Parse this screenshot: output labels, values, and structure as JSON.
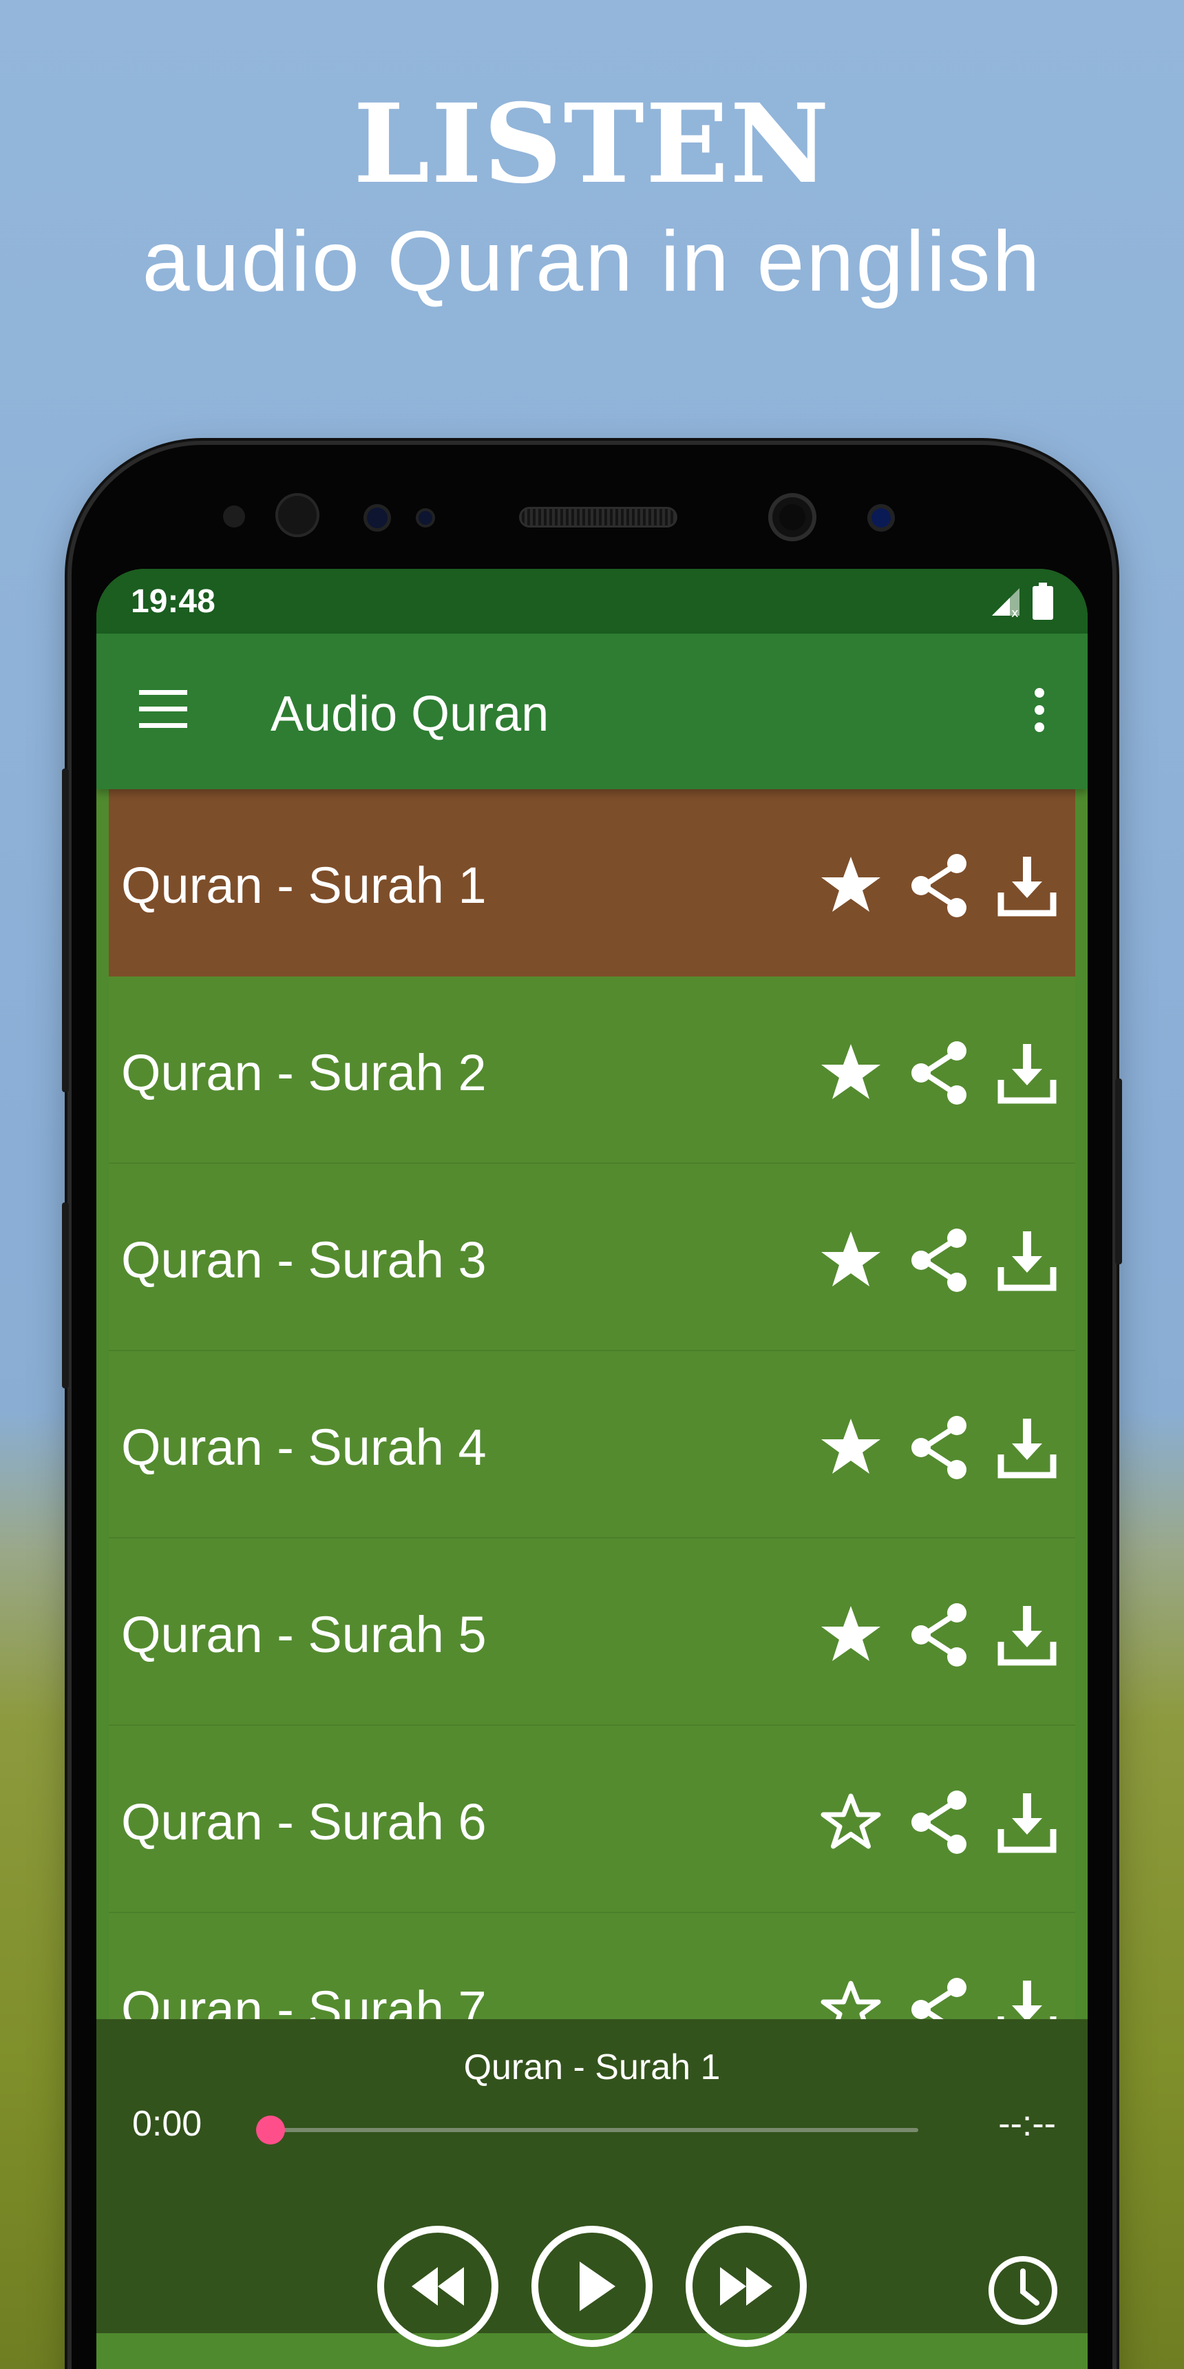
{
  "promo": {
    "title": "LISTEN",
    "subtitle": "audio Quran in english"
  },
  "status_bar": {
    "time": "19:48"
  },
  "app_bar": {
    "title": "Audio Quran",
    "menu_icon": "hamburger-menu-icon",
    "overflow_icon": "more-vert-icon"
  },
  "surahs": [
    {
      "label": "Quran - Surah 1",
      "favorite": true,
      "active": true
    },
    {
      "label": "Quran - Surah 2",
      "favorite": true,
      "active": false
    },
    {
      "label": "Quran - Surah 3",
      "favorite": true,
      "active": false
    },
    {
      "label": "Quran - Surah 4",
      "favorite": true,
      "active": false
    },
    {
      "label": "Quran - Surah 5",
      "favorite": true,
      "active": false
    },
    {
      "label": "Quran - Surah 6",
      "favorite": false,
      "active": false
    },
    {
      "label": "Quran - Surah 7",
      "favorite": false,
      "active": false
    }
  ],
  "player": {
    "now_playing": "Quran - Surah 1",
    "current_time": "0:00",
    "duration": "--:--",
    "progress": 0
  },
  "colors": {
    "status_bar": "#1b5e20",
    "app_bar": "#2e7d32",
    "list_row": "#548b2f",
    "active_row": "#7d4e2a",
    "player_bg": "#33531c",
    "seek_accent": "#ff4f8b"
  }
}
